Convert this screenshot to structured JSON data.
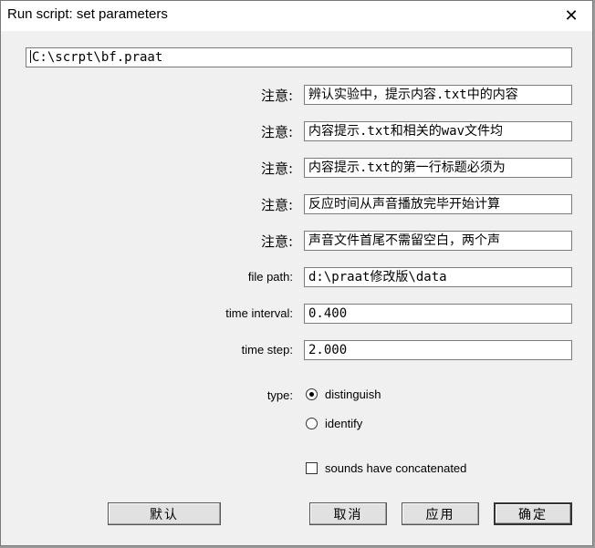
{
  "window": {
    "title": "Run script: set parameters"
  },
  "fields": {
    "script_path": "C:\\scrpt\\bf.praat",
    "notes": [
      {
        "label": "注意:",
        "value": "辨认实验中，提示内容.txt中的内容"
      },
      {
        "label": "注意:",
        "value": "内容提示.txt和相关的wav文件均"
      },
      {
        "label": "注意:",
        "value": "内容提示.txt的第一行标题必须为"
      },
      {
        "label": "注意:",
        "value": "反应时间从声音播放完毕开始计算"
      },
      {
        "label": "注意:",
        "value": "声音文件首尾不需留空白，两个声"
      }
    ],
    "file_path": {
      "label": "file path:",
      "value": "d:\\praat修改版\\data"
    },
    "time_interval": {
      "label": "time interval:",
      "value": "0.400"
    },
    "time_step": {
      "label": "time step:",
      "value": "2.000"
    }
  },
  "type": {
    "label": "type:",
    "options": [
      {
        "label": "distinguish",
        "selected": true
      },
      {
        "label": "identify",
        "selected": false
      }
    ]
  },
  "concatenated": {
    "label": "sounds have concatenated",
    "checked": false
  },
  "buttons": {
    "default": "默认",
    "cancel": "取消",
    "apply": "应用",
    "ok": "确定"
  },
  "icons": {
    "close": "close-icon"
  }
}
